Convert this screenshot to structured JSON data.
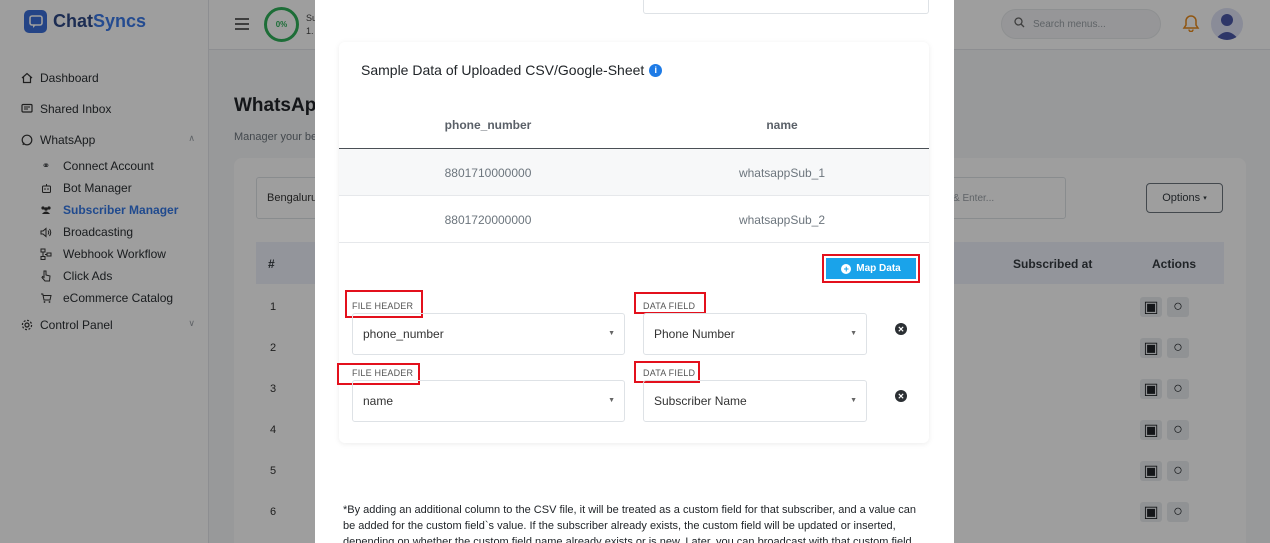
{
  "app": {
    "brand_prefix": "Chat",
    "brand_suffix": "Syncs"
  },
  "sidebar": {
    "items": [
      {
        "label": "Dashboard",
        "icon": "home-icon"
      },
      {
        "label": "Shared Inbox",
        "icon": "inbox-icon"
      },
      {
        "label": "WhatsApp",
        "icon": "whatsapp-icon",
        "expanded": true
      },
      {
        "label": "Control Panel",
        "icon": "gear-icon"
      }
    ],
    "whatsapp_sub": [
      {
        "label": "Connect Account",
        "icon": "link-icon"
      },
      {
        "label": "Bot Manager",
        "icon": "robot-icon"
      },
      {
        "label": "Subscriber Manager",
        "icon": "users-icon",
        "active": true
      },
      {
        "label": "Broadcasting",
        "icon": "megaphone-icon"
      },
      {
        "label": "Webhook Workflow",
        "icon": "workflow-icon"
      },
      {
        "label": "Click Ads",
        "icon": "pointer-icon"
      },
      {
        "label": "eCommerce Catalog",
        "icon": "cart-icon"
      }
    ]
  },
  "topbar": {
    "progress": "0%",
    "progress_text_1": "Su",
    "progress_text_2": "1.",
    "search_placeholder": "Search menus..."
  },
  "page": {
    "title": "WhatsAp",
    "subtitle": "Manager your be",
    "filter_select": "Bengaluru",
    "search_placeholder": "& Enter...",
    "options_label": "Options",
    "table_headers": {
      "num": "#",
      "subscribed_at": "Subscribed at",
      "actions": "Actions"
    },
    "row_numbers": [
      "1",
      "2",
      "3",
      "4",
      "5",
      "6"
    ]
  },
  "modal": {
    "sample_title": "Sample Data of Uploaded CSV/Google-Sheet",
    "columns": [
      "phone_number",
      "name"
    ],
    "rows": [
      [
        "8801710000000",
        "whatsappSub_1"
      ],
      [
        "8801720000000",
        "whatsappSub_2"
      ]
    ],
    "map_button": "Map Data",
    "mappings": [
      {
        "file_header_label": "FILE HEADER",
        "file_header_value": "phone_number",
        "data_field_label": "DATA FIELD",
        "data_field_value": "Phone Number"
      },
      {
        "file_header_label": "FILE HEADER",
        "file_header_value": "name",
        "data_field_label": "DATA FIELD",
        "data_field_value": "Subscriber Name"
      }
    ],
    "note": "*By adding an additional column to the CSV file, it will be treated as a custom field for that subscriber, and a value can be added for the custom field`s value. If the subscriber already exists, the custom field will be updated or inserted, depending on whether the custom field name already exists or is new. Later, you can broadcast with that custom field."
  },
  "colors": {
    "accent": "#3578e5",
    "map_button": "#1aa3ea",
    "highlight": "#e3101c"
  }
}
